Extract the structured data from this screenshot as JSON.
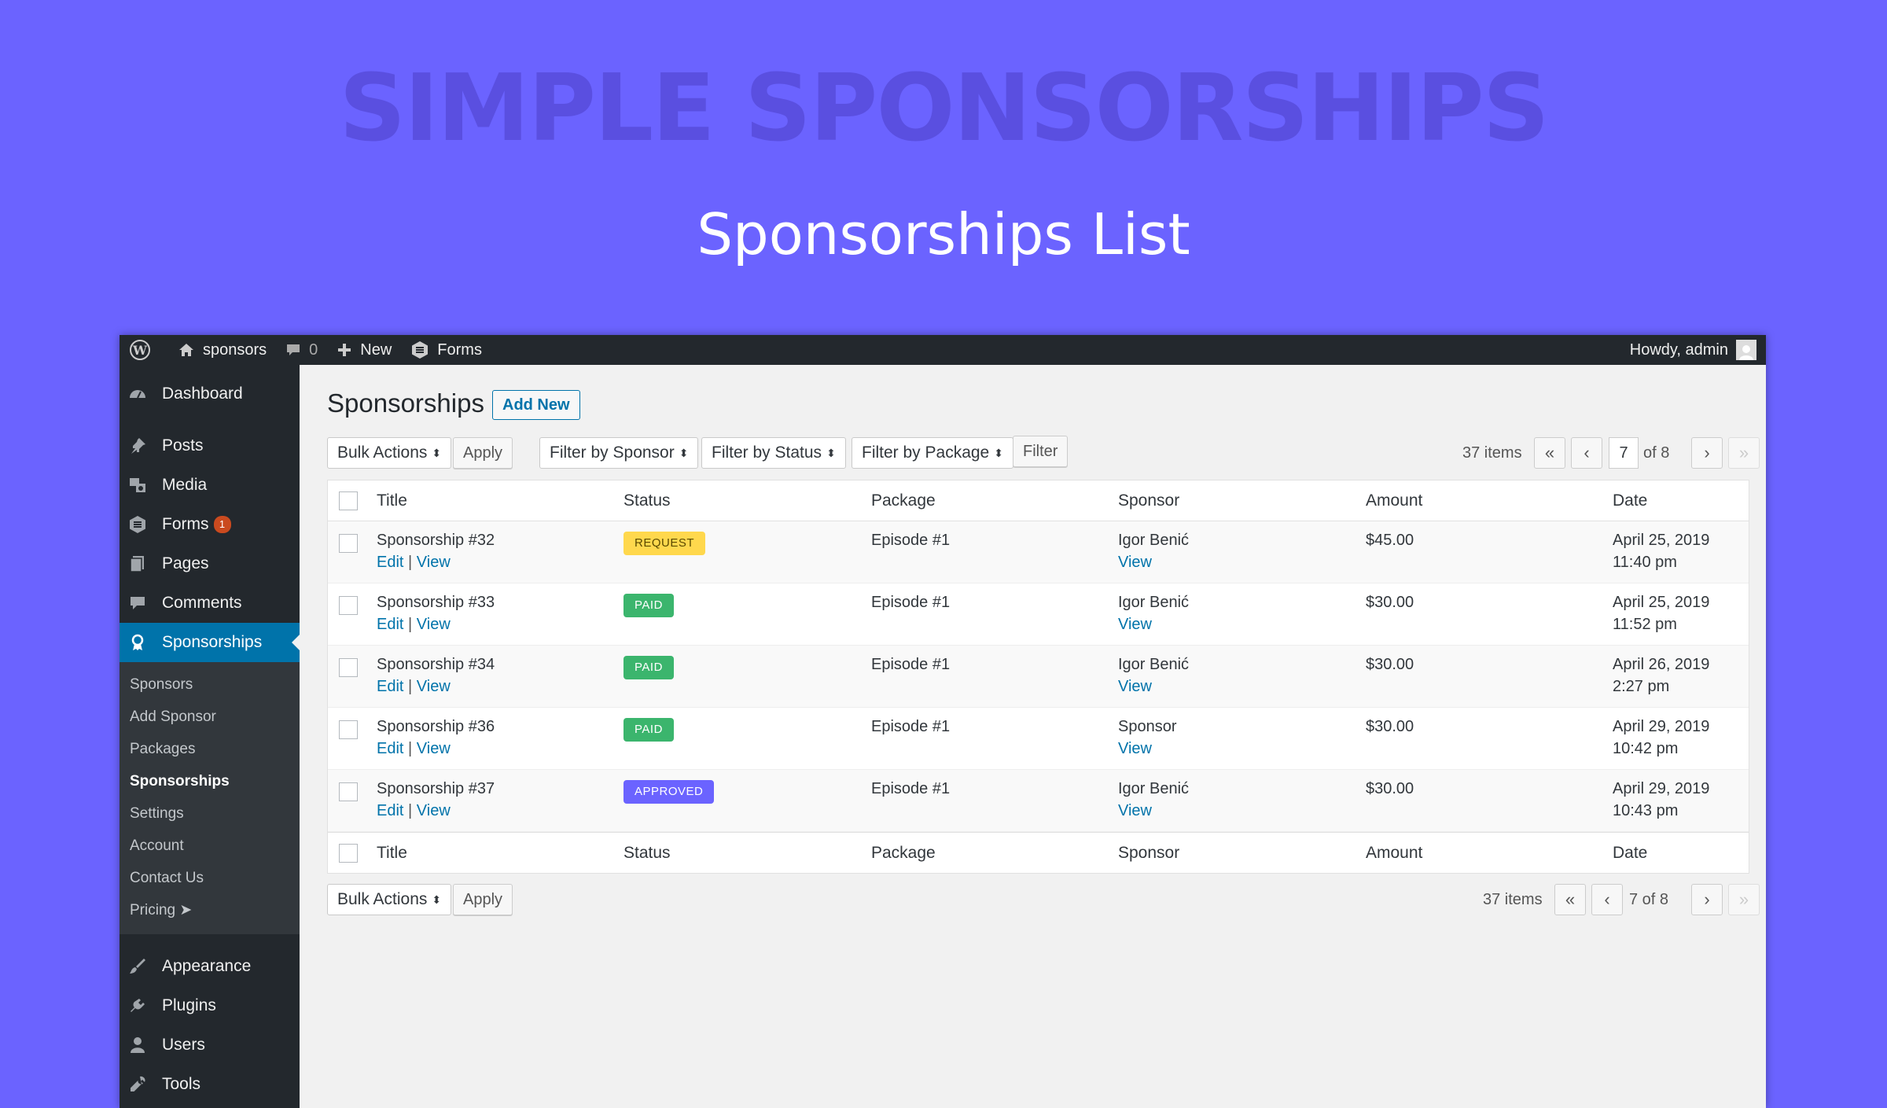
{
  "hero": {
    "title": "SIMPLE SPONSORSHIPS",
    "subtitle": "Sponsorships List"
  },
  "adminbar": {
    "site_name": "sponsors",
    "comments_count": "0",
    "new_label": "New",
    "forms_label": "Forms",
    "howdy": "Howdy, admin"
  },
  "sidebar": {
    "dashboard": "Dashboard",
    "posts": "Posts",
    "media": "Media",
    "forms": "Forms",
    "forms_badge": "1",
    "pages": "Pages",
    "comments": "Comments",
    "sponsorships": "Sponsorships",
    "submenu": [
      "Sponsors",
      "Add Sponsor",
      "Packages",
      "Sponsorships",
      "Settings",
      "Account",
      "Contact Us",
      "Pricing ➤"
    ],
    "appearance": "Appearance",
    "plugins": "Plugins",
    "users": "Users",
    "tools": "Tools"
  },
  "page": {
    "title": "Sponsorships",
    "add_new": "Add New"
  },
  "toolbar": {
    "bulk_actions": "Bulk Actions",
    "apply": "Apply",
    "filter_sponsor": "Filter by Sponsor",
    "filter_status": "Filter by Status",
    "filter_package": "Filter by Package",
    "filter": "Filter",
    "items": "37 items",
    "first": "«",
    "prev": "‹",
    "current_page": "7",
    "of_total": "of 8",
    "next": "›",
    "last": "»",
    "bottom_page_text": "7 of 8"
  },
  "table": {
    "headers": [
      "Title",
      "Status",
      "Package",
      "Sponsor",
      "Amount",
      "Date"
    ],
    "row_actions": {
      "edit": "Edit",
      "sep": "|",
      "view": "View"
    },
    "rows": [
      {
        "title": "Sponsorship #32",
        "status": "REQUEST",
        "status_color": "#ffd84d",
        "status_text_color": "#5a4a00",
        "package": "Episode #1",
        "sponsor": "Igor Benić",
        "sponsor_link": "View",
        "amount": "$45.00",
        "date": "April 25, 2019",
        "time": "11:40 pm"
      },
      {
        "title": "Sponsorship #33",
        "status": "PAID",
        "status_color": "#3bb56d",
        "status_text_color": "#ffffff",
        "package": "Episode #1",
        "sponsor": "Igor Benić",
        "sponsor_link": "View",
        "amount": "$30.00",
        "date": "April 25, 2019",
        "time": "11:52 pm"
      },
      {
        "title": "Sponsorship #34",
        "status": "PAID",
        "status_color": "#3bb56d",
        "status_text_color": "#ffffff",
        "package": "Episode #1",
        "sponsor": "Igor Benić",
        "sponsor_link": "View",
        "amount": "$30.00",
        "date": "April 26, 2019",
        "time": "2:27 pm"
      },
      {
        "title": "Sponsorship #36",
        "status": "PAID",
        "status_color": "#3bb56d",
        "status_text_color": "#ffffff",
        "package": "Episode #1",
        "sponsor": "Sponsor",
        "sponsor_link": "View",
        "amount": "$30.00",
        "date": "April 29, 2019",
        "time": "10:42 pm"
      },
      {
        "title": "Sponsorship #37",
        "status": "APPROVED",
        "status_color": "#6b63ff",
        "status_text_color": "#ffffff",
        "package": "Episode #1",
        "sponsor": "Igor Benić",
        "sponsor_link": "View",
        "amount": "$30.00",
        "date": "April 29, 2019",
        "time": "10:43 pm"
      }
    ]
  },
  "colors": {
    "background": "#6b63ff",
    "admin_dark": "#23282d",
    "accent": "#0073aa"
  }
}
